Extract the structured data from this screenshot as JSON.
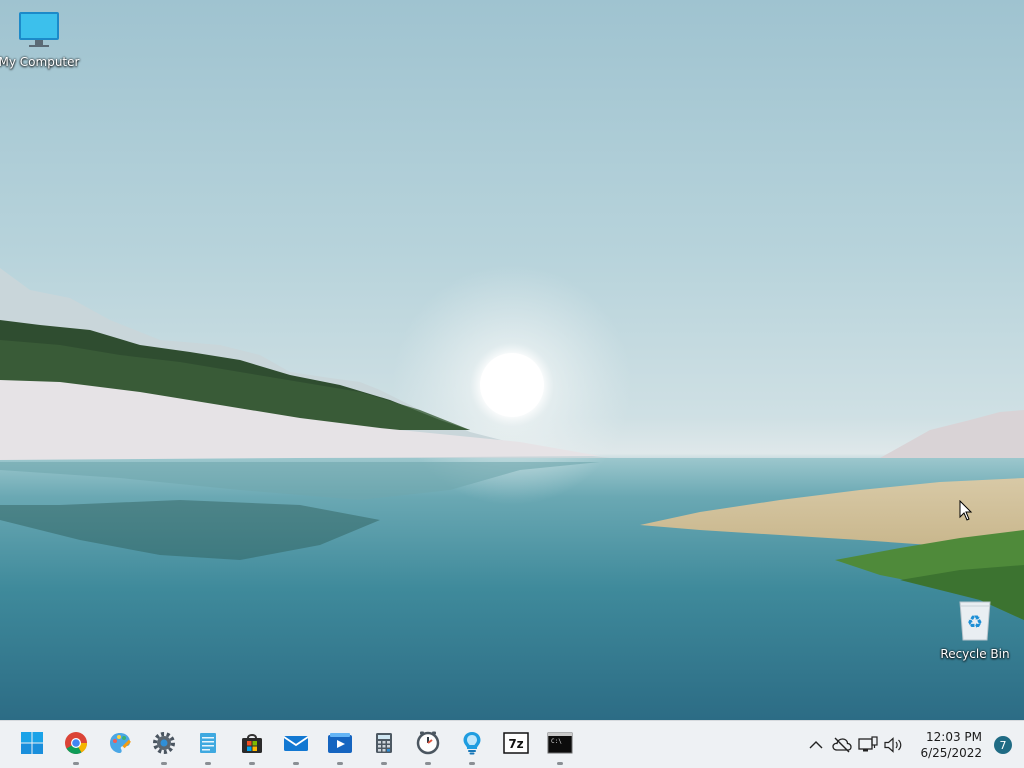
{
  "desktop": {
    "icons": [
      {
        "label": "My Computer",
        "icon": "monitor-icon"
      },
      {
        "label": "Recycle Bin",
        "icon": "recycle-bin-icon"
      }
    ]
  },
  "taskbar": {
    "apps": [
      {
        "name": "Start",
        "icon": "windows-start-icon",
        "running": false
      },
      {
        "name": "Google Chrome",
        "icon": "chrome-icon",
        "running": true
      },
      {
        "name": "Paint",
        "icon": "paint-icon",
        "running": false
      },
      {
        "name": "Settings",
        "icon": "gear-icon",
        "running": true
      },
      {
        "name": "Notepad",
        "icon": "notepad-icon",
        "running": true
      },
      {
        "name": "Microsoft Store",
        "icon": "store-icon",
        "running": true
      },
      {
        "name": "Mail",
        "icon": "mail-icon",
        "running": true
      },
      {
        "name": "Media Player",
        "icon": "media-player-icon",
        "running": true
      },
      {
        "name": "Calculator",
        "icon": "calculator-icon",
        "running": true
      },
      {
        "name": "Clock",
        "icon": "clock-icon",
        "running": true
      },
      {
        "name": "Tips",
        "icon": "lightbulb-icon",
        "running": true
      },
      {
        "name": "7-Zip",
        "icon": "seven-zip-icon",
        "running": false
      },
      {
        "name": "Terminal",
        "icon": "terminal-icon",
        "running": true
      }
    ],
    "tray": {
      "icons": [
        "chevron-up-icon",
        "cloud-offline-icon",
        "network-icon",
        "volume-icon"
      ],
      "time": "12:03 PM",
      "date": "6/25/2022",
      "notification_count": "7"
    }
  },
  "colors": {
    "taskbar_bg": "#eef1f4",
    "accent": "#0078d4",
    "badge": "#1f6b84"
  }
}
